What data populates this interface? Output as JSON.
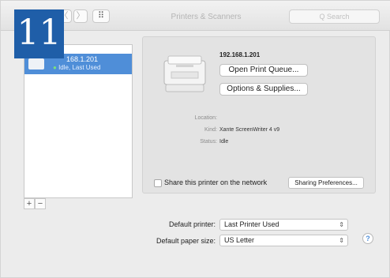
{
  "window": {
    "title": "Printers & Scanners"
  },
  "titlebar": {
    "back_icon": "chevron-left",
    "forward_label": "〉",
    "grid_label": "⠿",
    "search_placeholder": "Q Search"
  },
  "badge": {
    "number": "11"
  },
  "sidebar": {
    "printers": [
      {
        "name": "192.168.1.201",
        "name_visible": "168.1.201",
        "status": "Idle, Last Used"
      }
    ],
    "add_label": "+",
    "remove_label": "−"
  },
  "detail": {
    "printer_ip": "192.168.1.201",
    "open_queue_label": "Open Print Queue...",
    "options_label": "Options & Supplies...",
    "location_label": "Location:",
    "location_value": "",
    "kind_label": "Kind:",
    "kind_value": "Xante ScreenWriter 4 v9",
    "status_label": "Status:",
    "status_value": "Idle",
    "share_label": "Share this printer on the network",
    "share_checked": false,
    "sharing_prefs_label": "Sharing Preferences..."
  },
  "defaults": {
    "printer_label": "Default printer:",
    "printer_value": "Last Printer Used",
    "paper_label": "Default paper size:",
    "paper_value": "US Letter"
  },
  "help": {
    "label": "?"
  },
  "colors": {
    "accent": "#4f8ed8",
    "badge": "#1f5ea8"
  }
}
